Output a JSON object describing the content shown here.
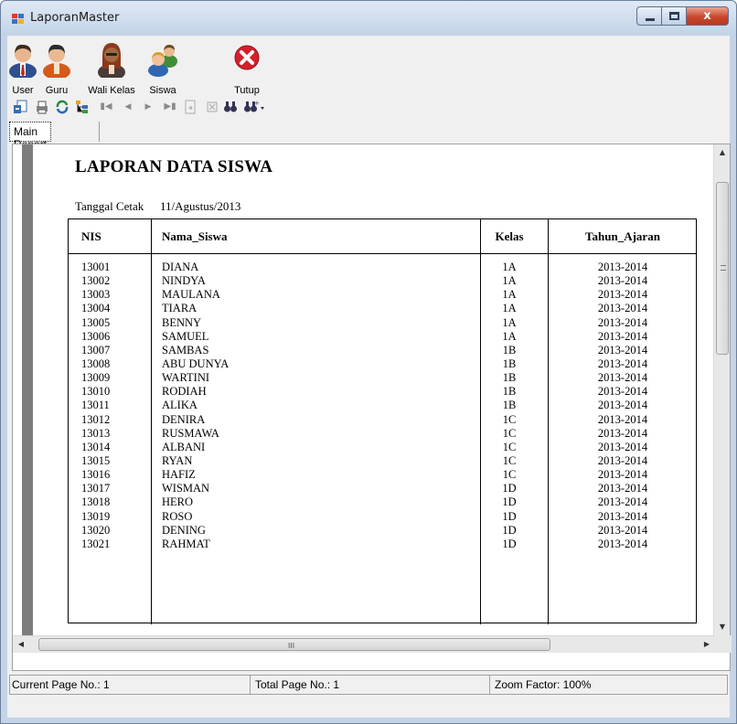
{
  "window": {
    "title": "LaporanMaster",
    "close_glyph": "x"
  },
  "toolbar": {
    "buttons": [
      {
        "label": "User",
        "icon": "user-icon"
      },
      {
        "label": "Guru",
        "icon": "teacher-icon"
      },
      {
        "label": "Wali Kelas",
        "icon": "homeroom-teacher-icon"
      },
      {
        "label": "Siswa",
        "icon": "students-icon"
      },
      {
        "label": "Tutup",
        "icon": "close-circle-icon"
      }
    ]
  },
  "report_toolbar": {
    "icons": [
      "export-icon",
      "print-icon",
      "refresh-icon",
      "group-tree-icon",
      "first-page-icon",
      "previous-page-icon",
      "next-page-icon",
      "last-page-icon",
      "goto-page-icon",
      "stop-icon",
      "find-icon",
      "zoom-icon"
    ]
  },
  "tabs": {
    "main_report": "Main Report"
  },
  "report": {
    "title": "LAPORAN DATA SISWA",
    "date_label": "Tanggal Cetak",
    "date_value": "11/Agustus/2013",
    "columns": [
      "NIS",
      "Nama_Siswa",
      "Kelas",
      "Tahun_Ajaran"
    ],
    "rows": [
      [
        "13001",
        "DIANA",
        "1A",
        "2013-2014"
      ],
      [
        "13002",
        "NINDYA",
        "1A",
        "2013-2014"
      ],
      [
        "13003",
        "MAULANA",
        "1A",
        "2013-2014"
      ],
      [
        "13004",
        "TIARA",
        "1A",
        "2013-2014"
      ],
      [
        "13005",
        "BENNY",
        "1A",
        "2013-2014"
      ],
      [
        "13006",
        "SAMUEL",
        "1A",
        "2013-2014"
      ],
      [
        "13007",
        "SAMBAS",
        "1B",
        "2013-2014"
      ],
      [
        "13008",
        "ABU DUNYA",
        "1B",
        "2013-2014"
      ],
      [
        "13009",
        "WARTINI",
        "1B",
        "2013-2014"
      ],
      [
        "13010",
        "RODIAH",
        "1B",
        "2013-2014"
      ],
      [
        "13011",
        "ALIKA",
        "1B",
        "2013-2014"
      ],
      [
        "13012",
        "DENIRA",
        "1C",
        "2013-2014"
      ],
      [
        "13013",
        "RUSMAWA",
        "1C",
        "2013-2014"
      ],
      [
        "13014",
        "ALBANI",
        "1C",
        "2013-2014"
      ],
      [
        "13015",
        "RYAN",
        "1C",
        "2013-2014"
      ],
      [
        "13016",
        "HAFIZ",
        "1C",
        "2013-2014"
      ],
      [
        "13017",
        "WISMAN",
        "1D",
        "2013-2014"
      ],
      [
        "13018",
        "HERO",
        "1D",
        "2013-2014"
      ],
      [
        "13019",
        "ROSO",
        "1D",
        "2013-2014"
      ],
      [
        "13020",
        "DENING",
        "1D",
        "2013-2014"
      ],
      [
        "13021",
        "RAHMAT",
        "1D",
        "2013-2014"
      ]
    ]
  },
  "statusbar": {
    "current_page": "Current Page No.: 1",
    "total_page": "Total Page No.: 1",
    "zoom": "Zoom Factor: 100%"
  },
  "scrollbar": {
    "h_grip": "III"
  },
  "colors": {
    "close_button": "#c9472d",
    "title_bar": "#c2d3e8",
    "page_gutter": "#7d7d7d"
  }
}
